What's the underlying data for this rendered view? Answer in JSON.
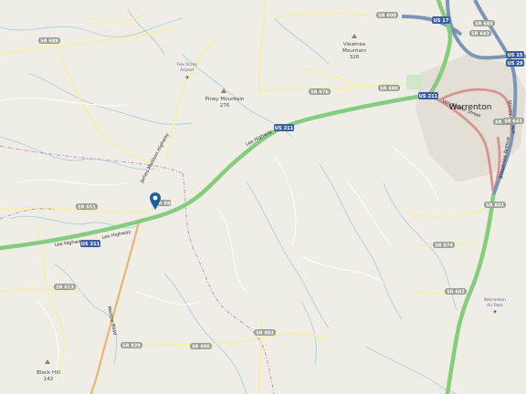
{
  "map": {
    "colors": {
      "background": "#efede6",
      "primary_road": "#86cc7e",
      "trunk_road": "#7d95b8",
      "secondary_road": "#d9948f",
      "tertiary_road": "#f4f0a8",
      "stream": "#a9cfe0",
      "boundary": "#b08fbf",
      "marker": "#1f5f9a",
      "shield": "#9a9f93"
    },
    "places": {
      "town": "Warrenton",
      "viewtree_name": "Viewtree",
      "viewtree_line2": "Mountain",
      "viewtree_elev": "326",
      "piney_name": "Piney Mountain",
      "piney_elev": "276",
      "blackhill_name": "Black Hill",
      "blackhill_elev": "142",
      "fox_acres_line1": "Fox Acres",
      "fox_acres_line2": "Airport",
      "warrenton_air_line1": "Warrenton",
      "warrenton_air_line2": "Air Park"
    },
    "roads": {
      "lee_highway_1": "Lee Highway",
      "lee_highway_2": "Lee Highway",
      "lee_highway_3": "Lee Highway",
      "james_madison": "James Madison Highway",
      "meetze_road": "Meetze Road",
      "winchester": "Winchester Street",
      "broadview": "Broadview Avenue",
      "shirley": "Shirley Avenue"
    },
    "shields": {
      "us211_a": "US 211",
      "us211_b": "US 211",
      "us211_c": "US 211",
      "us17": "US 17",
      "us15": "US 15",
      "us29": "US 29",
      "sr600_top": "SR 600",
      "sr688": "SR 688",
      "sr680": "SR 680",
      "sr676": "SR 676",
      "sr690": "SR 690",
      "sr651": "SR 651",
      "sr613": "SR 613",
      "sr643": "SR 643",
      "sr672": "SR 672",
      "sr802_right": "SR 802",
      "sr874": "SR 874",
      "sr602": "SR 602",
      "sr600_bottom": "SR 600",
      "sr802_bottom": "SR 802",
      "sr829": "SR 829",
      "sr643_right": "SR 643",
      "sr685": "SR 685"
    }
  }
}
